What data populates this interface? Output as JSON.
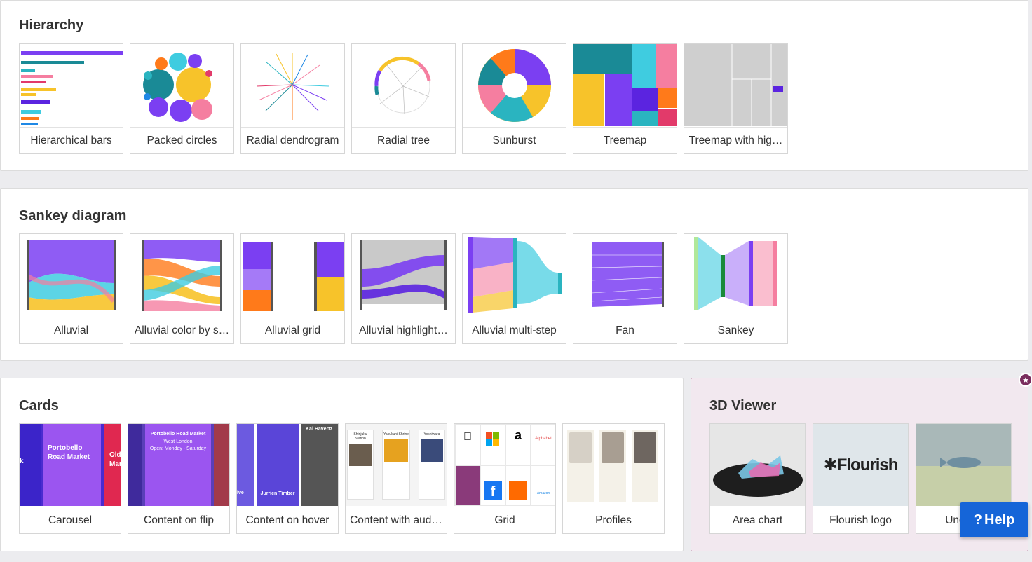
{
  "sections": {
    "hierarchy": {
      "title": "Hierarchy",
      "tiles": [
        "Hierarchical bars",
        "Packed circles",
        "Radial dendrogram",
        "Radial tree",
        "Sunburst",
        "Treemap",
        "Treemap with hig…"
      ]
    },
    "sankey": {
      "title": "Sankey diagram",
      "tiles": [
        "Alluvial",
        "Alluvial color by s…",
        "Alluvial grid",
        "Alluvial highlight…",
        "Alluvial multi-step",
        "Fan",
        "Sankey"
      ]
    },
    "cards": {
      "title": "Cards",
      "tiles": [
        "Carousel",
        "Content on flip",
        "Content on hover",
        "Content with aud…",
        "Grid",
        "Profiles"
      ],
      "thumb_text": {
        "carousel_main": "Portobello Road Market",
        "carousel_left": "k",
        "carousel_right": "Old Mar",
        "flip_main": "Portobello Road Market",
        "flip_sub": "West London",
        "flip_hours": "Open: Monday - Saturday",
        "hover_name": "Kai Havertz",
        "hover_player": "Jurrien Timber",
        "hover_left": "ive",
        "audio_stations": [
          "Shinjuku Station",
          "Yasukuni Shrine",
          "Yoshiwara"
        ],
        "grid_texts": [
          "Alphabet",
          "Facebook",
          "Alibaba",
          "Amazon"
        ]
      }
    },
    "viewer": {
      "title": "3D Viewer",
      "tiles": [
        "Area chart",
        "Flourish logo",
        "Unde…"
      ],
      "logo_text": "Flourish"
    }
  },
  "help": {
    "label": "Help",
    "icon": "?"
  },
  "colors": {
    "accent_purple": "#7b3ff2",
    "help_blue": "#1565d8",
    "viewer_bg": "#f2e8ef",
    "viewer_border": "#7a2d5e"
  }
}
